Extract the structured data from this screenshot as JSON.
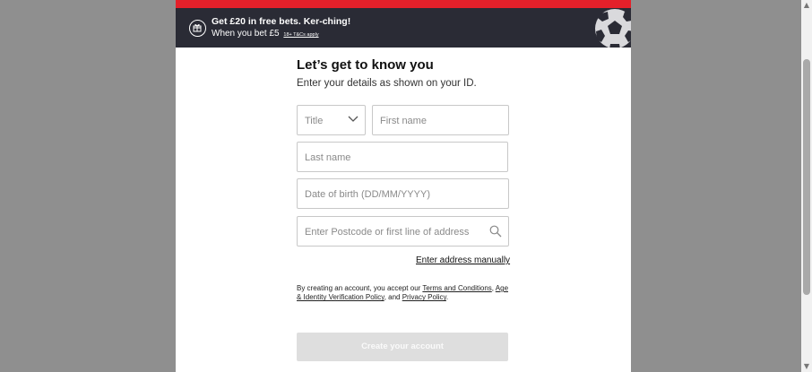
{
  "promo": {
    "title": "Get £20 in free bets. Ker-ching!",
    "subtitle": "When you bet £5",
    "terms": "18+ T&Cs apply",
    "icon": "gift-icon"
  },
  "form": {
    "heading": "Let’s get to know you",
    "subheading": "Enter your details as shown on your ID.",
    "title_placeholder": "Title",
    "first_name_placeholder": "First name",
    "last_name_placeholder": "Last name",
    "dob_placeholder": "Date of birth (DD/MM/YYYY)",
    "address_placeholder": "Enter Postcode or first line of address",
    "manual_address_link": "Enter address manually",
    "legal": {
      "intro": "By creating an account, you accept our",
      "terms_link": "Terms and Conditions",
      "sep1": ",",
      "age_link": "Age & Identity Verification Policy",
      "sep2": ", and",
      "privacy_link": "Privacy Policy",
      "end": "."
    },
    "submit_label": "Create your account"
  },
  "colors": {
    "accent_red": "#e4202a",
    "promo_bg": "#2a2b35",
    "button_disabled": "#dedede",
    "backdrop": "#8f8f8f"
  }
}
